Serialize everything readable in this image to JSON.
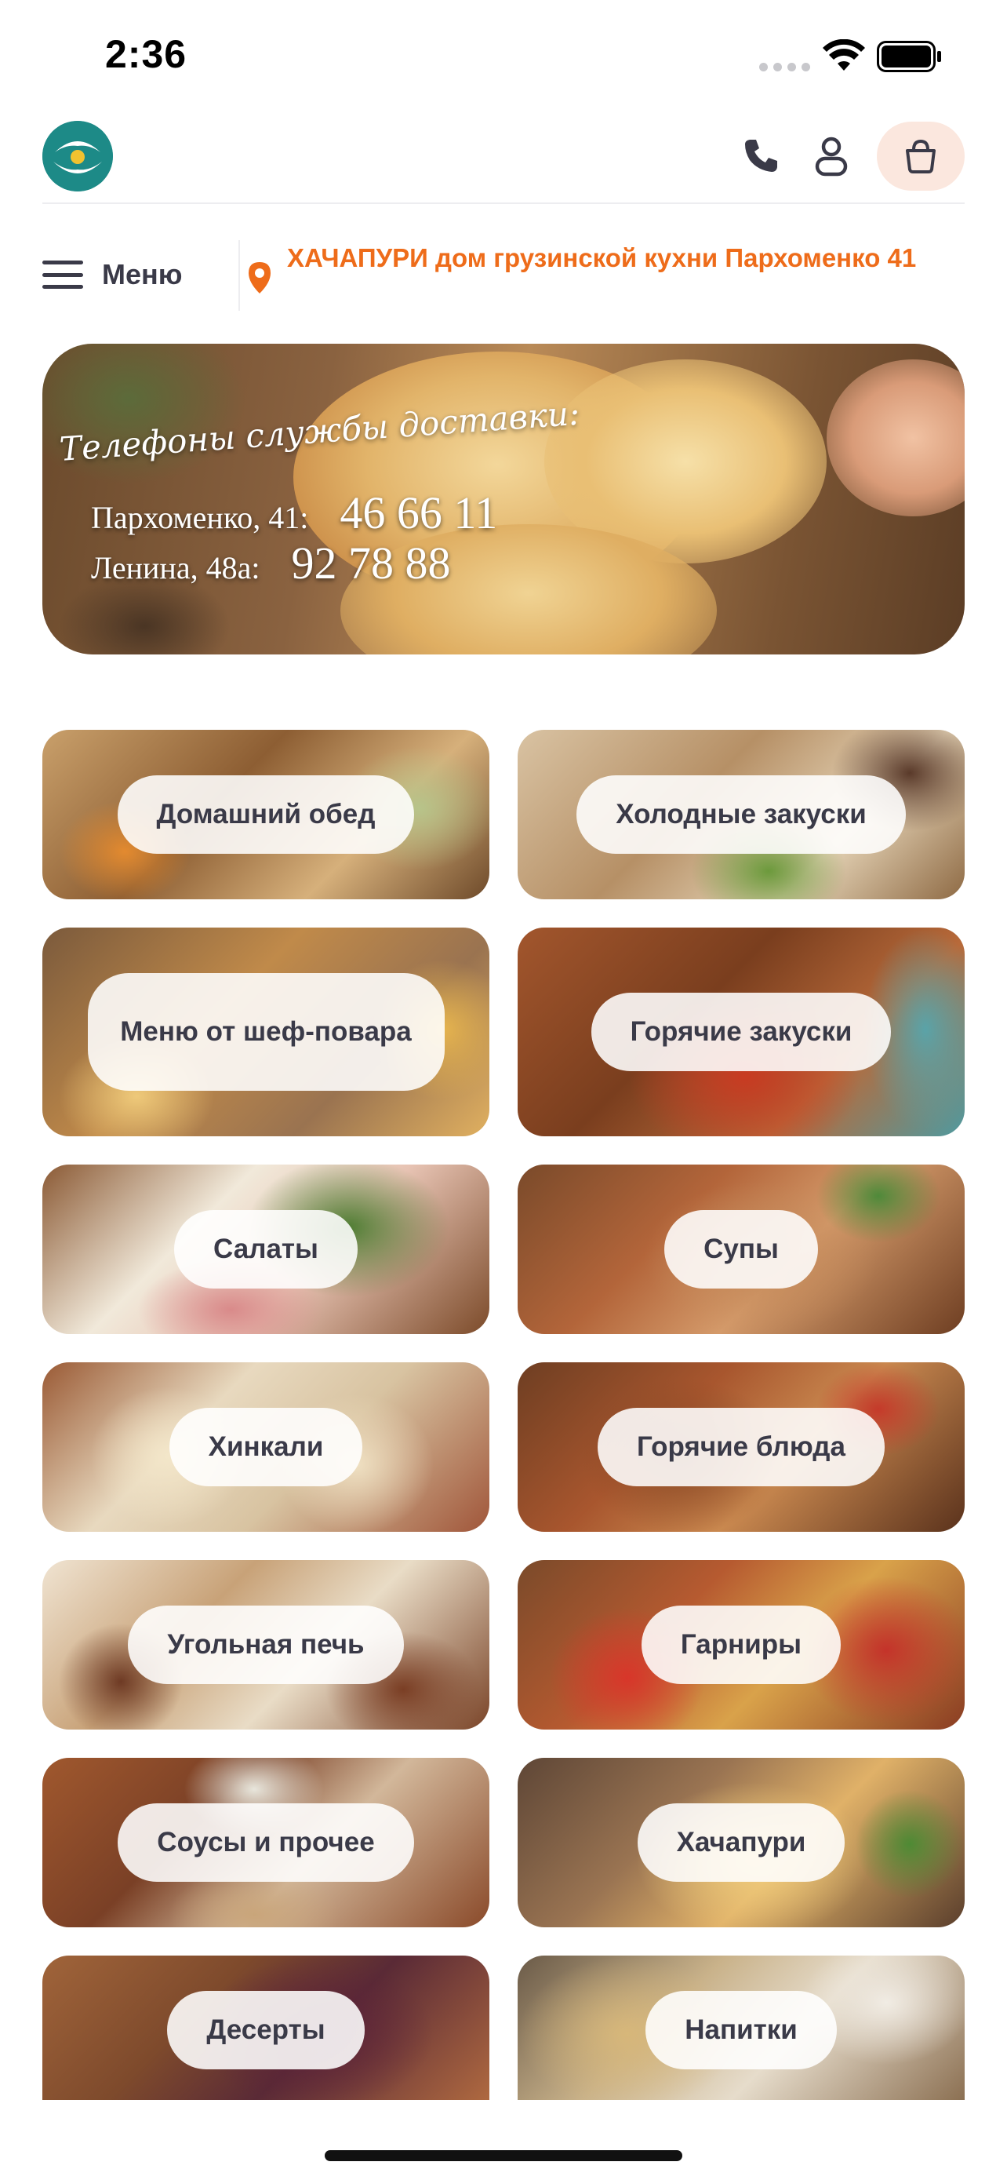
{
  "status_bar": {
    "time": "2:36"
  },
  "header": {
    "logo_icon": "hands-logo-icon",
    "phone_icon": "phone-icon",
    "user_icon": "user-icon",
    "cart_icon": "cart-bag-icon"
  },
  "nav": {
    "menu_label": "Меню",
    "location": "ХАЧАПУРИ дом грузинской кухни Пархоменко 41"
  },
  "banner": {
    "title": "Телефоны службы доставки:",
    "rows": [
      {
        "label": "Пархоменко, 41:",
        "number": "46 66 11"
      },
      {
        "label": "Ленина, 48а:",
        "number": "92 78 88"
      }
    ]
  },
  "categories": [
    {
      "label": "Домашний обед"
    },
    {
      "label": "Холодные закуски"
    },
    {
      "label": "Меню от шеф-повара"
    },
    {
      "label": "Горячие закуски"
    },
    {
      "label": "Салаты"
    },
    {
      "label": "Супы"
    },
    {
      "label": "Хинкали"
    },
    {
      "label": "Горячие блюда"
    },
    {
      "label": "Угольная печь"
    },
    {
      "label": "Гарниры"
    },
    {
      "label": "Соусы и прочее"
    },
    {
      "label": "Хачапури"
    },
    {
      "label": "Десерты"
    },
    {
      "label": "Напитки"
    }
  ],
  "colors": {
    "accent": "#ee6c1a",
    "text": "#3a3a48",
    "logo": "#1d8a87",
    "cart_bg": "#fbe7de"
  }
}
